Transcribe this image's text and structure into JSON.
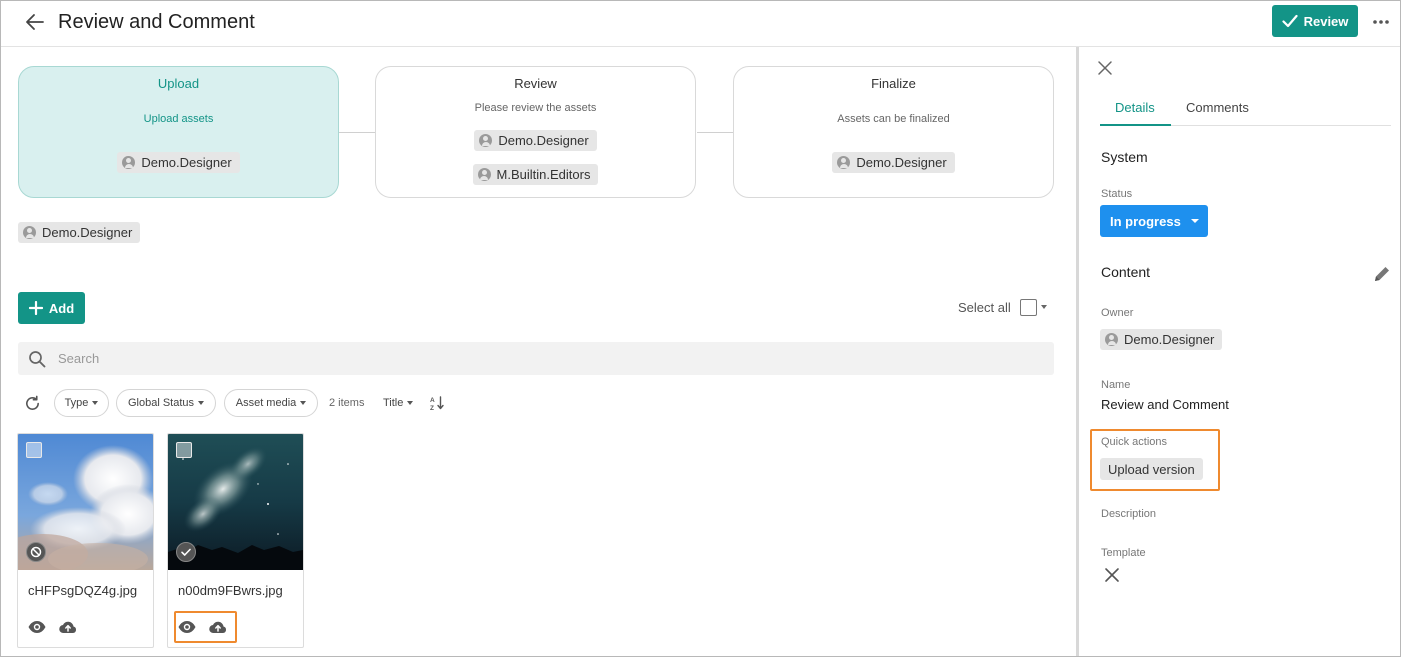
{
  "header": {
    "title": "Review and Comment",
    "review_label": "Review"
  },
  "workflow": {
    "steps": [
      {
        "title": "Upload",
        "description": "Upload assets",
        "assignees": [
          "Demo.Designer"
        ]
      },
      {
        "title": "Review",
        "description": "Please review the assets",
        "assignees": [
          "Demo.Designer",
          "M.Builtin.Editors"
        ]
      },
      {
        "title": "Finalize",
        "description": "Assets can be finalized",
        "assignees": [
          "Demo.Designer"
        ]
      }
    ],
    "owner_chip": "Demo.Designer"
  },
  "toolbar": {
    "add_label": "Add",
    "select_all_label": "Select all",
    "search_placeholder": "Search",
    "filters": [
      "Type",
      "Global Status",
      "Asset media"
    ],
    "items_count": "2 items",
    "sort_label": "Title"
  },
  "assets": [
    {
      "filename": "cHFPsgDQZ4g.jpg",
      "status": "blocked-icon"
    },
    {
      "filename": "n00dm9FBwrs.jpg",
      "status": "check-icon"
    }
  ],
  "panel": {
    "tabs": [
      "Details",
      "Comments"
    ],
    "active_tab": "Details",
    "system_title": "System",
    "status_label": "Status",
    "status_value": "In progress",
    "content_title": "Content",
    "owner_label": "Owner",
    "owner_value": "Demo.Designer",
    "name_label": "Name",
    "name_value": "Review and Comment",
    "quick_actions_label": "Quick actions",
    "quick_action": "Upload version",
    "description_label": "Description",
    "template_label": "Template"
  },
  "colors": {
    "accent": "#139487",
    "status": "#1e90ee",
    "highlight": "#ef8a2f",
    "active_step_bg": "#d9f0ef"
  }
}
